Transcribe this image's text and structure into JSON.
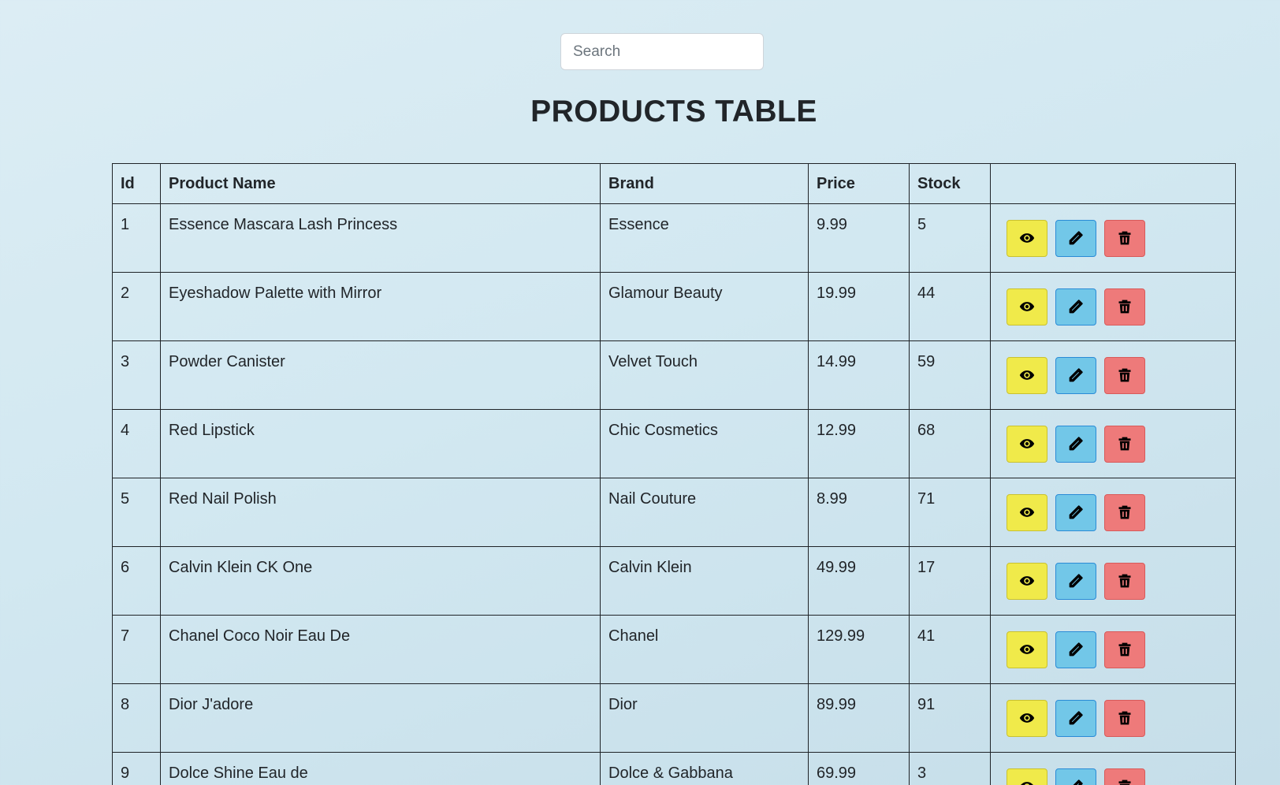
{
  "search": {
    "placeholder": "Search",
    "value": ""
  },
  "page": {
    "title": "PRODUCTS TABLE"
  },
  "table": {
    "headers": {
      "id": "Id",
      "name": "Product Name",
      "brand": "Brand",
      "price": "Price",
      "stock": "Stock",
      "actions": ""
    },
    "rows": [
      {
        "id": "1",
        "name": "Essence Mascara Lash Princess",
        "brand": "Essence",
        "price": "9.99",
        "stock": "5"
      },
      {
        "id": "2",
        "name": "Eyeshadow Palette with Mirror",
        "brand": "Glamour Beauty",
        "price": "19.99",
        "stock": "44"
      },
      {
        "id": "3",
        "name": "Powder Canister",
        "brand": "Velvet Touch",
        "price": "14.99",
        "stock": "59"
      },
      {
        "id": "4",
        "name": "Red Lipstick",
        "brand": "Chic Cosmetics",
        "price": "12.99",
        "stock": "68"
      },
      {
        "id": "5",
        "name": "Red Nail Polish",
        "brand": "Nail Couture",
        "price": "8.99",
        "stock": "71"
      },
      {
        "id": "6",
        "name": "Calvin Klein CK One",
        "brand": "Calvin Klein",
        "price": "49.99",
        "stock": "17"
      },
      {
        "id": "7",
        "name": "Chanel Coco Noir Eau De",
        "brand": "Chanel",
        "price": "129.99",
        "stock": "41"
      },
      {
        "id": "8",
        "name": "Dior J'adore",
        "brand": "Dior",
        "price": "89.99",
        "stock": "91"
      },
      {
        "id": "9",
        "name": "Dolce Shine Eau de",
        "brand": "Dolce & Gabbana",
        "price": "69.99",
        "stock": "3"
      }
    ],
    "row_actions": {
      "view_icon": "eye-icon",
      "edit_icon": "pencil-icon",
      "delete_icon": "trash-icon"
    }
  },
  "colors": {
    "view_button": "#f0ea4a",
    "edit_button": "#72c7e8",
    "delete_button": "#ee7a7a"
  }
}
